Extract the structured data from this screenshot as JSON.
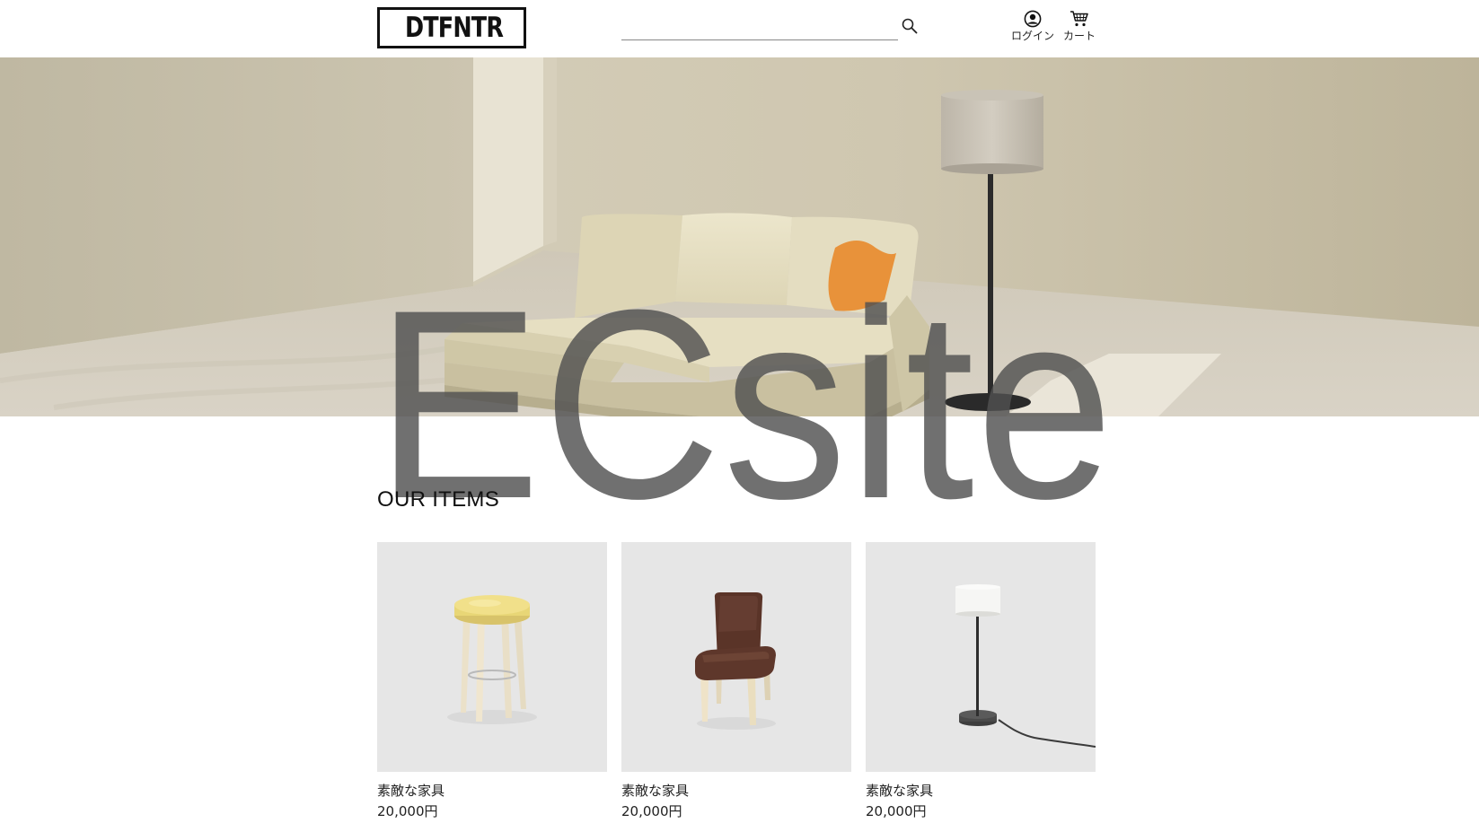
{
  "header": {
    "logo_text": "DTFNTR",
    "search": {
      "value": "",
      "placeholder": ""
    },
    "login_label": "ログイン",
    "cart_label": "カート"
  },
  "hero": {
    "title": "ECsite"
  },
  "items_section": {
    "title": "OUR ITEMS",
    "items": [
      {
        "name": "素敵な家具",
        "price": "20,000円",
        "image": "stool"
      },
      {
        "name": "素敵な家具",
        "price": "20,000円",
        "image": "leather-chair"
      },
      {
        "name": "素敵な家具",
        "price": "20,000円",
        "image": "floor-lamp"
      }
    ]
  },
  "colors": {
    "hero_wall": "#ddd8c8",
    "sofa": "#e6dfc2",
    "cushion": "#e8923a",
    "card_bg": "#e6e6e6",
    "title_overlay": "#505050"
  },
  "icons": [
    "armchair-logo-icon",
    "search-icon",
    "user-icon",
    "cart-icon"
  ]
}
